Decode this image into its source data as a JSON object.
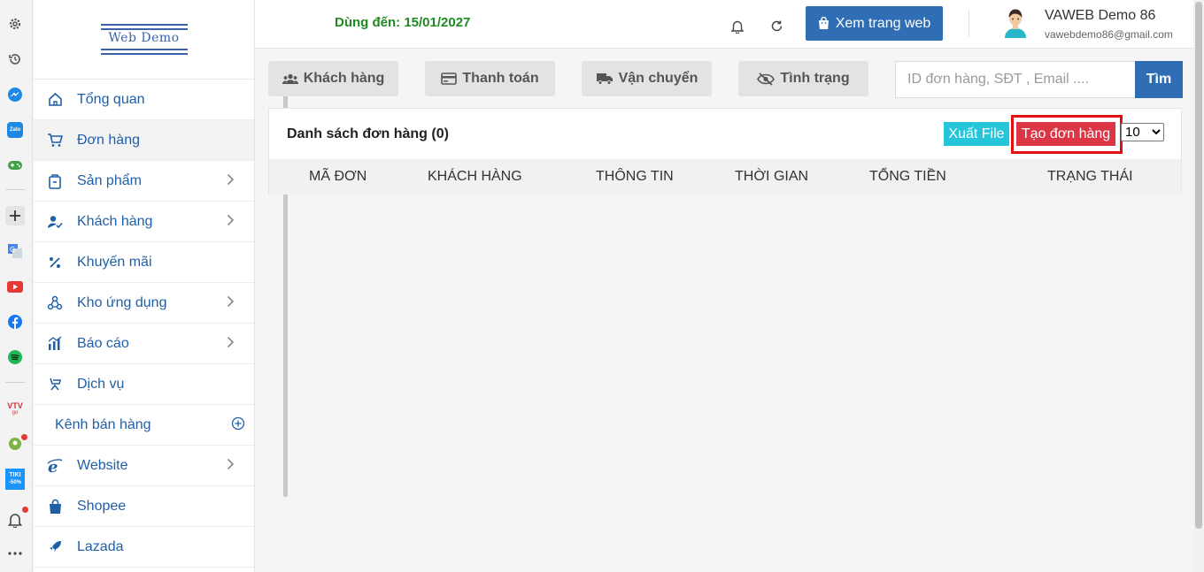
{
  "sidebar": {
    "logo_text": "Web Demo",
    "items": [
      {
        "label": "Tổng quan",
        "icon": "home-icon",
        "chevron": false
      },
      {
        "label": "Đơn hàng",
        "icon": "cart-icon",
        "chevron": false,
        "active": true
      },
      {
        "label": "Sản phẩm",
        "icon": "package-icon",
        "chevron": true
      },
      {
        "label": "Khách hàng",
        "icon": "user-check-icon",
        "chevron": true
      },
      {
        "label": "Khuyến mãi",
        "icon": "percent-icon",
        "chevron": false
      },
      {
        "label": "Kho ứng dụng",
        "icon": "apps-icon",
        "chevron": true
      },
      {
        "label": "Báo cáo",
        "icon": "chart-icon",
        "chevron": true
      },
      {
        "label": "Dịch vụ",
        "icon": "service-icon",
        "chevron": false
      }
    ],
    "section_label": "Kênh bán hàng",
    "channels": [
      {
        "label": "Website",
        "icon": "ie-icon",
        "chevron": true
      },
      {
        "label": "Shopee",
        "icon": "shopping-bag-icon",
        "chevron": false
      },
      {
        "label": "Lazada",
        "icon": "rocket-icon",
        "chevron": false
      }
    ]
  },
  "header": {
    "expiry": "Dùng đến: 15/01/2027",
    "view_site": "Xem trang web",
    "user_name": "VAWEB Demo 86",
    "user_email": "vawebdemo86@gmail.com"
  },
  "filters": {
    "customers": "Khách hàng",
    "payment": "Thanh toán",
    "shipping": "Vận chuyển",
    "status": "Tình trạng",
    "search_placeholder": "ID đơn hàng, SĐT , Email ....",
    "search_button": "Tìm"
  },
  "orders": {
    "title": "Danh sách đơn hàng (0)",
    "export": "Xuất File",
    "create": "Tạo đơn hàng",
    "per_page": "10",
    "columns": [
      "Mã đơn",
      "Khách hàng",
      "Thông tin",
      "Thời gian",
      "Tổng tiền",
      "Trạng thái"
    ]
  },
  "browser_strip": {
    "zalo_label": "Zalo",
    "vtv_label": "VTV",
    "vtv_sub": "go",
    "tiki_label": "TIKI",
    "tiki_sub": "-50%"
  },
  "colors": {
    "primary": "#2f6eb5",
    "expiry_green": "#1e8a22",
    "export_cyan": "#26c6da",
    "create_red": "#dc3545"
  }
}
